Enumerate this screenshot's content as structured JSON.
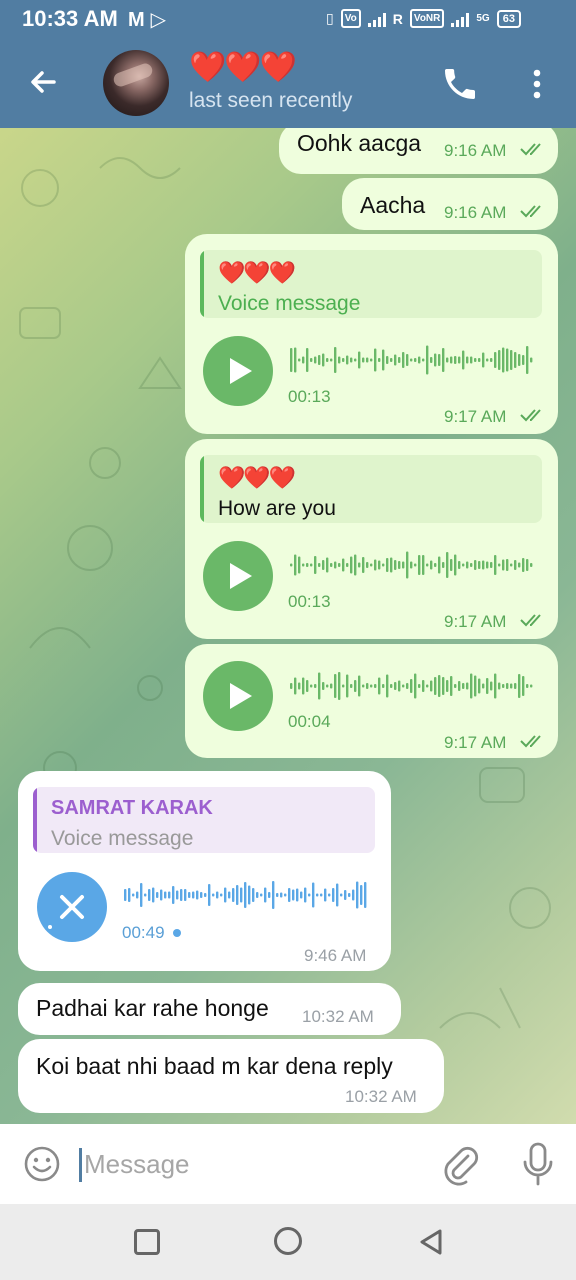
{
  "status_bar": {
    "time": "10:33 AM",
    "battery": "63"
  },
  "header": {
    "contact_name": "❤️❤️❤️",
    "status": "last seen recently"
  },
  "messages": [
    {
      "text": "Oohk aacga",
      "time": "9:16 AM"
    },
    {
      "text": "Aacha",
      "time": "9:16 AM"
    },
    {
      "reply_to": "❤️❤️❤️",
      "reply_text": "Voice message",
      "duration": "00:13",
      "time": "9:17 AM"
    },
    {
      "reply_to": "❤️❤️❤️",
      "reply_text": "How are you",
      "duration": "00:13",
      "time": "9:17 AM"
    },
    {
      "duration": "00:04",
      "time": "9:17 AM"
    },
    {
      "reply_to": "SAMRAT KARAK",
      "reply_text": "Voice message",
      "duration": "00:49",
      "time": "9:46 AM"
    },
    {
      "text": "Padhai kar rahe honge",
      "time": "10:32 AM"
    },
    {
      "text": "Koi baat nhi baad m kar dena reply",
      "time": "10:32 AM"
    }
  ],
  "input": {
    "placeholder": "Message",
    "value": ""
  },
  "colors": {
    "header": "#517da2",
    "outgoing_bubble": "#effedd",
    "incoming_bubble": "#ffffff",
    "accent_green": "#6ab868",
    "accent_blue": "#5aa7e6",
    "reply_name_purple": "#9c5fcf"
  },
  "icons": [
    "back-arrow-icon",
    "phone-icon",
    "more-vert-icon",
    "play-icon",
    "cancel-icon",
    "double-check-icon",
    "emoji-icon",
    "attach-icon",
    "mic-icon",
    "recents-icon",
    "home-icon",
    "back-triangle-icon"
  ]
}
